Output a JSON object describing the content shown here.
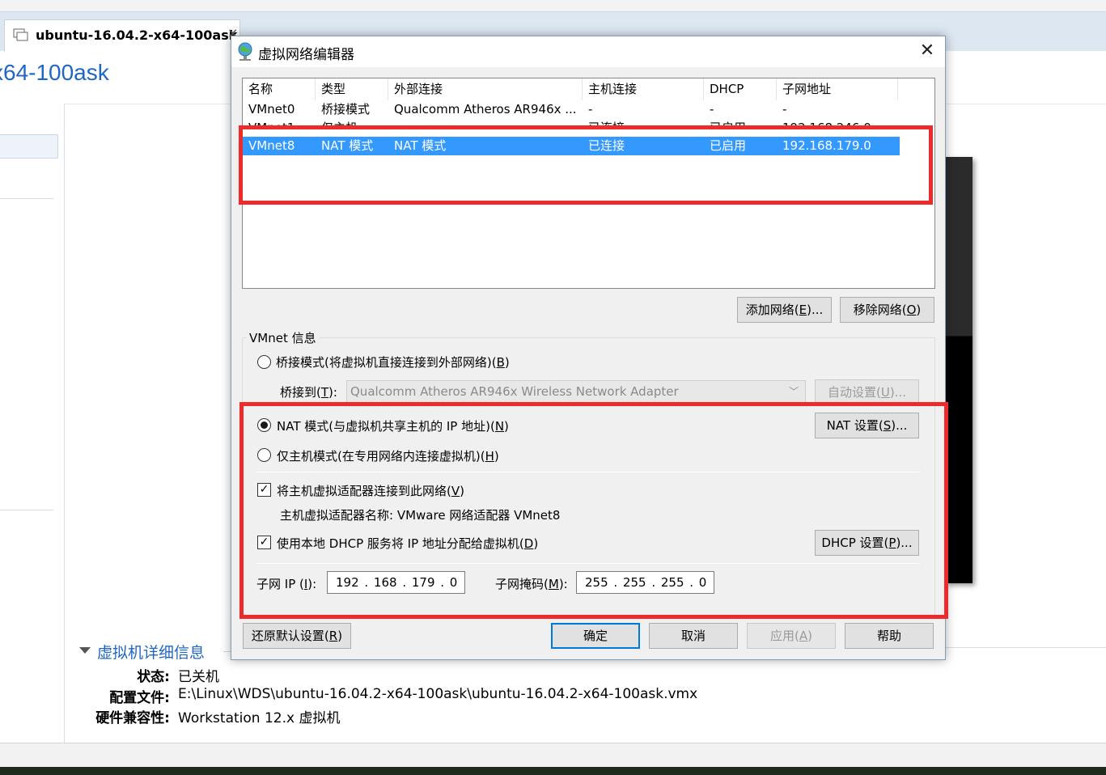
{
  "workstation": {
    "tab_label": "ubuntu-16.04.2-x64-100ask",
    "tab_close": "×",
    "vm_title": "x64-100ask",
    "details": {
      "header": "虚拟机详细信息",
      "rows": [
        {
          "key": "状态:",
          "value": "已关机"
        },
        {
          "key": "配置文件:",
          "value": "E:\\Linux\\WDS\\ubuntu-16.04.2-x64-100ask\\ubuntu-16.04.2-x64-100ask.vmx"
        },
        {
          "key": "硬件兼容性:",
          "value": "Workstation 12.x 虚拟机"
        }
      ]
    }
  },
  "dialog": {
    "title": "虚拟网络编辑器",
    "close": "✕",
    "table": {
      "columns": [
        "名称",
        "类型",
        "外部连接",
        "主机连接",
        "DHCP",
        "子网地址"
      ],
      "rows": [
        [
          "VMnet0",
          "桥接模式",
          "Qualcomm Atheros AR946x ...",
          "-",
          "-",
          "-"
        ],
        [
          "VMnet1",
          "仅主机...",
          "",
          "已连接",
          "已启用",
          "192.168.246.0"
        ],
        [
          "VMnet8",
          "NAT 模式",
          "NAT 模式",
          "已连接",
          "已启用",
          "192.168.179.0"
        ]
      ],
      "selected_row": 2
    },
    "buttons": {
      "add_network": {
        "text": "添加网络(",
        "key": "E",
        "tail": ")..."
      },
      "remove_network": {
        "text": "移除网络(",
        "key": "O",
        "tail": ")"
      },
      "auto_settings": {
        "text": "自动设置(",
        "key": "U",
        "tail": ")..."
      },
      "nat_settings": {
        "text": "NAT 设置(",
        "key": "S",
        "tail": ")..."
      },
      "dhcp_settings": {
        "text": "DHCP 设置(",
        "key": "P",
        "tail": ")..."
      },
      "restore_defaults": {
        "text": "还原默认设置(",
        "key": "R",
        "tail": ")"
      },
      "ok": "确定",
      "cancel": "取消",
      "apply": {
        "text": "应用(",
        "key": "A",
        "tail": ")"
      },
      "help": "帮助"
    },
    "vmnet_info": {
      "group_label": "VMnet 信息",
      "bridged": {
        "text": "桥接模式(将虚拟机直接连接到外部网络)(",
        "key": "B",
        "tail": ")",
        "checked": false
      },
      "bridge_to": {
        "text": "桥接到(",
        "key": "T",
        "tail": "):",
        "value": "Qualcomm Atheros AR946x Wireless Network Adapter"
      },
      "nat": {
        "text": "NAT 模式(与虚拟机共享主机的 IP 地址)(",
        "key": "N",
        "tail": ")",
        "checked": true
      },
      "host_only": {
        "text": "仅主机模式(在专用网络内连接虚拟机)(",
        "key": "H",
        "tail": ")",
        "checked": false
      },
      "connect_adapter": {
        "text": "将主机虚拟适配器连接到此网络(",
        "key": "V",
        "tail": ")",
        "checked": true,
        "mark": "✓"
      },
      "adapter_name": "主机虚拟适配器名称: VMware 网络适配器 VMnet8",
      "use_dhcp": {
        "text": "使用本地 DHCP 服务将 IP 地址分配给虚拟机(",
        "key": "D",
        "tail": ")",
        "checked": true,
        "mark": "✓"
      },
      "subnet_ip": {
        "label_text": "子网 IP (",
        "key": "I",
        "tail": "):",
        "value": "192 . 168 . 179 .  0"
      },
      "subnet_mask": {
        "label_text": "子网掩码(",
        "key": "M",
        "tail": "):",
        "value": "255 . 255 . 255 .  0"
      }
    }
  },
  "colors": {
    "selection": "#3399ff",
    "highlight_box": "#ee2b2b",
    "link_blue": "#1f66c5"
  }
}
